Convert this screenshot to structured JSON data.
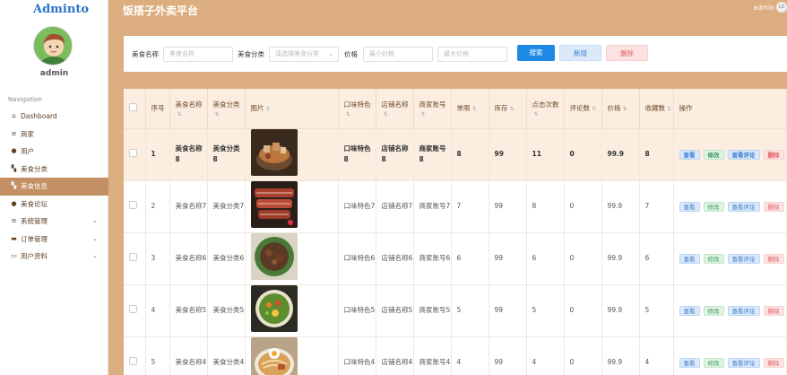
{
  "brand": "Adminto",
  "sidebar": {
    "username": "admin",
    "nav_label": "Navigation",
    "items": [
      {
        "label": "Dashboard",
        "icon": "home-icon",
        "glyph": "⌂",
        "active": false,
        "expandable": false
      },
      {
        "label": "商家",
        "icon": "list-icon",
        "glyph": "≡",
        "active": false,
        "expandable": false
      },
      {
        "label": "用户",
        "icon": "user-icon",
        "glyph": "●",
        "active": false,
        "expandable": false
      },
      {
        "label": "美食分类",
        "icon": "grid-icon",
        "glyph": "▚",
        "active": false,
        "expandable": false
      },
      {
        "label": "美食信息",
        "icon": "grid-icon",
        "glyph": "▚",
        "active": true,
        "expandable": false
      },
      {
        "label": "美食论坛",
        "icon": "user-icon",
        "glyph": "●",
        "active": false,
        "expandable": false
      },
      {
        "label": "系统管理",
        "icon": "list-icon",
        "glyph": "≡",
        "active": false,
        "expandable": true
      },
      {
        "label": "订单管理",
        "icon": "card-icon",
        "glyph": "▬",
        "active": false,
        "expandable": true
      },
      {
        "label": "用户资料",
        "icon": "window-icon",
        "glyph": "▭",
        "active": false,
        "expandable": true
      }
    ]
  },
  "header": {
    "title": "饭搭子外卖平台",
    "user": "admin",
    "avatar_text": "LS"
  },
  "search": {
    "name_label": "美食名称",
    "name_placeholder": "美食名称",
    "category_label": "美食分类",
    "category_placeholder": "请选择美食分类",
    "price_label": "价格",
    "min_price_placeholder": "最小价格",
    "max_price_placeholder": "最大价格",
    "search_button": "搜索",
    "add_button": "新增",
    "delete_button": "删除"
  },
  "table": {
    "columns": [
      "序号",
      "美食名称",
      "美食分类",
      "图片",
      "口味特色",
      "店铺名称",
      "商家账号",
      "单限",
      "库存",
      "点击次数",
      "评论数",
      "价格",
      "收藏数",
      "操作"
    ],
    "actions": {
      "view": "查看",
      "edit": "修改",
      "comments": "查看评论",
      "delete": "删除"
    },
    "rows": [
      {
        "index": "1",
        "name": "美食名称8",
        "category": "美食分类8",
        "image": "dish-bowl-icon",
        "flavor": "口味特色8",
        "shop": "店铺名称8",
        "merchant": "商家账号8",
        "limit": "8",
        "stock": "99",
        "clicks": "11",
        "comments": "0",
        "price": "99.9",
        "favorites": "8"
      },
      {
        "index": "2",
        "name": "美食名称7",
        "category": "美食分类7",
        "image": "steak-icon",
        "flavor": "口味特色7",
        "shop": "店铺名称7",
        "merchant": "商家账号7",
        "limit": "7",
        "stock": "99",
        "clicks": "8",
        "comments": "0",
        "price": "99.9",
        "favorites": "7"
      },
      {
        "index": "3",
        "name": "美食名称6",
        "category": "美食分类6",
        "image": "plate-icon",
        "flavor": "口味特色6",
        "shop": "店铺名称6",
        "merchant": "商家账号6",
        "limit": "6",
        "stock": "99",
        "clicks": "6",
        "comments": "0",
        "price": "99.9",
        "favorites": "6"
      },
      {
        "index": "4",
        "name": "美食名称5",
        "category": "美食分类5",
        "image": "salad-icon",
        "flavor": "口味特色5",
        "shop": "店铺名称5",
        "merchant": "商家账号5",
        "limit": "5",
        "stock": "99",
        "clicks": "5",
        "comments": "0",
        "price": "99.9",
        "favorites": "5"
      },
      {
        "index": "5",
        "name": "美食名称4",
        "category": "美食分类4",
        "image": "noodle-icon",
        "flavor": "口味特色4",
        "shop": "店铺名称4",
        "merchant": "商家账号4",
        "limit": "4",
        "stock": "99",
        "clicks": "4",
        "comments": "0",
        "price": "99.9",
        "favorites": "4"
      }
    ]
  }
}
